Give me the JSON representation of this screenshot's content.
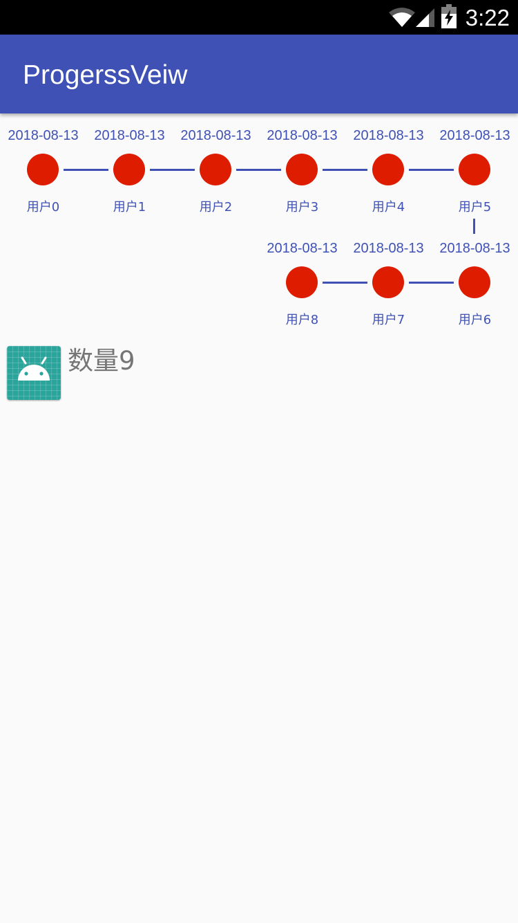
{
  "status_bar": {
    "time": "3:22",
    "icons": [
      "wifi-icon",
      "cell-signal-icon",
      "battery-charging-icon"
    ]
  },
  "app_bar": {
    "title": "ProgerssVeiw"
  },
  "progress": {
    "nodes": [
      {
        "date": "2018-08-13",
        "user": "用户0"
      },
      {
        "date": "2018-08-13",
        "user": "用户1"
      },
      {
        "date": "2018-08-13",
        "user": "用户2"
      },
      {
        "date": "2018-08-13",
        "user": "用户3"
      },
      {
        "date": "2018-08-13",
        "user": "用户4"
      },
      {
        "date": "2018-08-13",
        "user": "用户5"
      },
      {
        "date": "2018-08-13",
        "user": "用户6"
      },
      {
        "date": "2018-08-13",
        "user": "用户7"
      },
      {
        "date": "2018-08-13",
        "user": "用户8"
      }
    ],
    "dot_color": "#dd1c00",
    "line_color": "#3f51b5"
  },
  "count": {
    "icon": "android-launcher-icon",
    "label": "数量9"
  },
  "colors": {
    "primary": "#3f51b5",
    "status_bar": "#000000",
    "background": "#fafafa"
  }
}
